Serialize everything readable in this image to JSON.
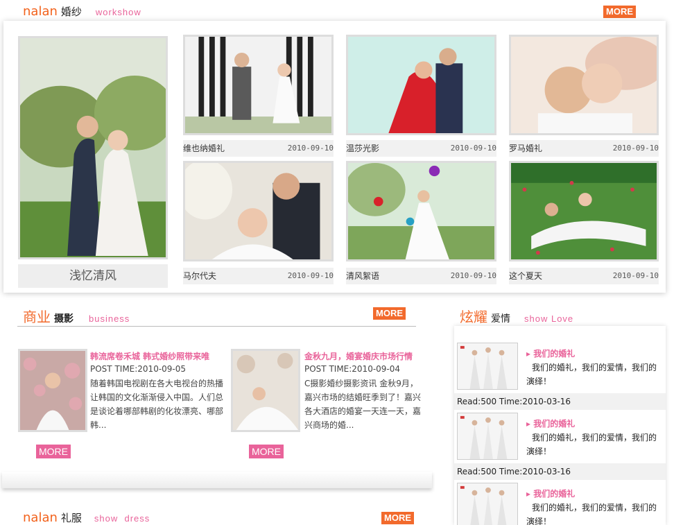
{
  "wedding": {
    "logo_en": "nalan",
    "title_cn": "婚纱",
    "subtitle_en": "workshow",
    "more_label": "MORE",
    "feature_caption": "浅忆清风",
    "items": [
      {
        "name": "维也纳婚礼",
        "date": "2010-09-10"
      },
      {
        "name": "温莎光影",
        "date": "2010-09-10"
      },
      {
        "name": "罗马婚礼",
        "date": "2010-09-10"
      },
      {
        "name": "马尔代夫",
        "date": "2010-09-10"
      },
      {
        "name": "清风絮语",
        "date": "2010-09-10"
      },
      {
        "name": "这个夏天",
        "date": "2010-09-10"
      }
    ]
  },
  "business": {
    "title_cn_1": "商业",
    "title_cn_2": "摄影",
    "subtitle_en": "business",
    "more_label": "MORE",
    "articles": [
      {
        "title": "韩流席卷禾城 韩式婚纱照带来唯",
        "post_time": "POST TIME:2010-09-05",
        "body": [
          "随着韩国电视剧在各大电视台的热播",
          "让韩国的文化渐渐侵入中国。人们总",
          "是谈论着哪部韩剧的化妆漂亮、哪部",
          "韩..."
        ],
        "more_label": "MORE"
      },
      {
        "title": "金秋九月，婚宴婚庆市场行情",
        "post_time": "POST TIME:2010-09-04",
        "body": [
          "C摄影婚纱摄影资讯    金秋9月，",
          "嘉兴市场的结婚旺季到了！嘉兴",
          "各大酒店的婚宴一天连一天，嘉",
          "兴商场的婚..."
        ],
        "more_label": "MORE"
      }
    ]
  },
  "love": {
    "title_cn_1": "炫耀",
    "title_cn_2": "爱情",
    "subtitle_en": "show Love",
    "entries": [
      {
        "title": "我们的婚礼",
        "body": "我们的婚礼，我们的爱情，我们的演绎！",
        "meta": "Read:500 Time:2010-03-16"
      },
      {
        "title": "我们的婚礼",
        "body": "我们的婚礼，我们的爱情，我们的演绎！",
        "meta": "Read:500 Time:2010-03-16"
      },
      {
        "title": "我们的婚礼",
        "body": "我们的婚礼，我们的爱情，我们的演绎！",
        "meta": ""
      }
    ]
  },
  "dress": {
    "logo_en": "nalan",
    "title_cn": "礼服",
    "subtitle_en": "show  dress",
    "more_label": "MORE"
  },
  "colors": {
    "accent_orange": "#f26a2c",
    "accent_pink": "#e9639a",
    "caption_bg": "#f1f1f1"
  }
}
